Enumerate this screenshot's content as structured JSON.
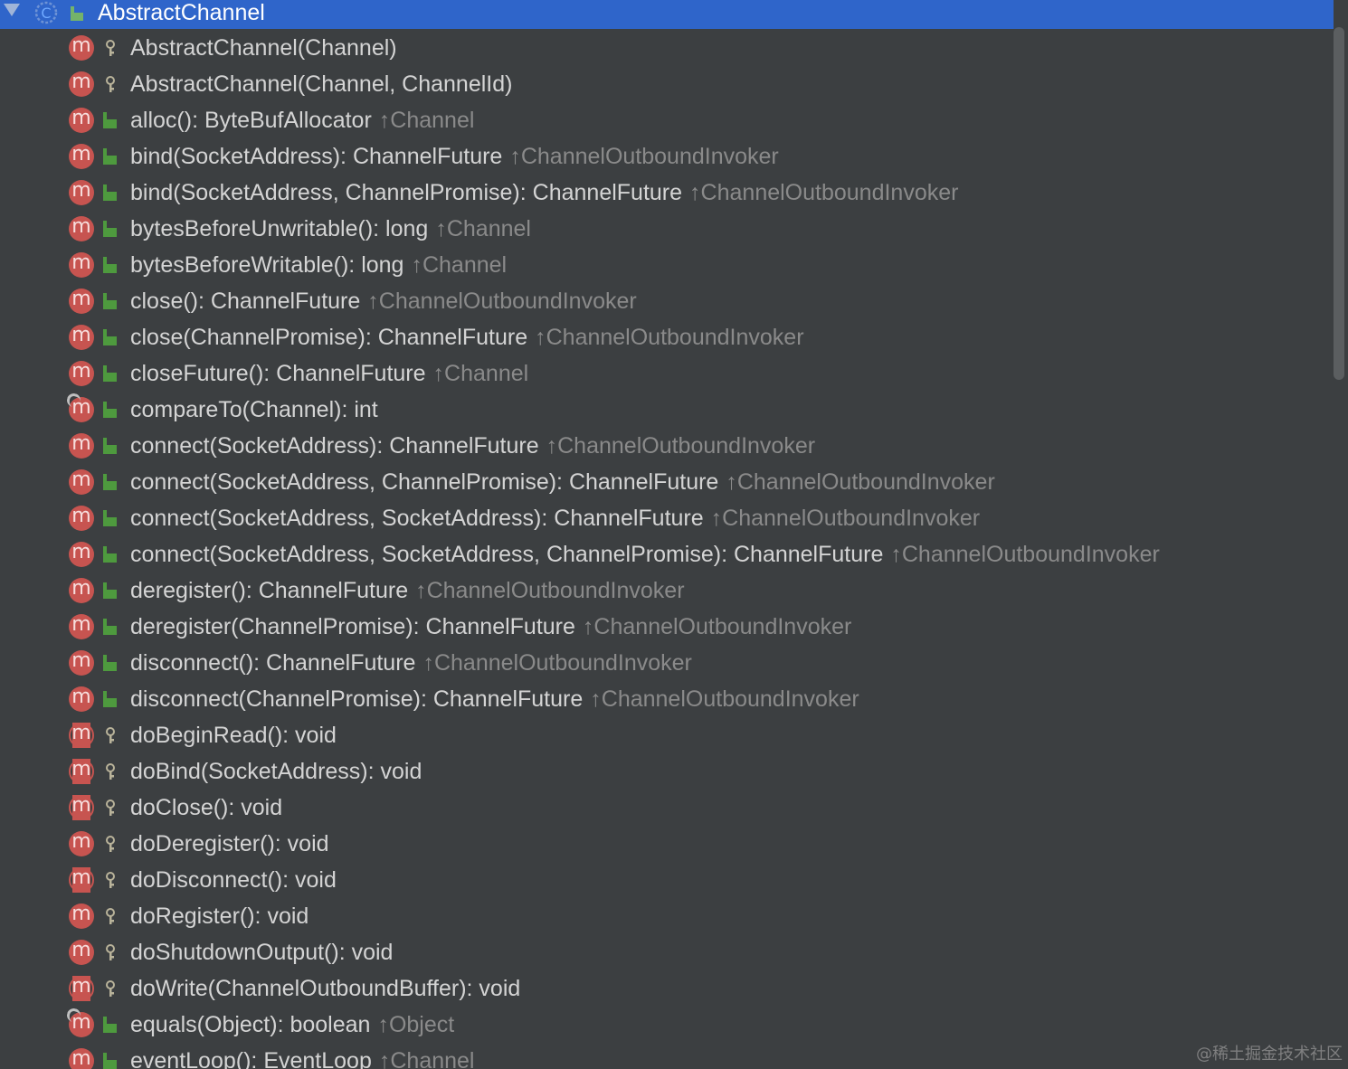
{
  "header": {
    "title": "AbstractChannel",
    "class_icon_letter": "C"
  },
  "members": [
    {
      "sig": "AbstractChannel(Channel)",
      "inherited": "",
      "visibility": "protected-icon",
      "kind": "method"
    },
    {
      "sig": "AbstractChannel(Channel, ChannelId)",
      "inherited": "",
      "visibility": "protected-icon",
      "kind": "method"
    },
    {
      "sig": "alloc(): ByteBufAllocator",
      "inherited": "↑Channel",
      "visibility": "public-icon",
      "kind": "method"
    },
    {
      "sig": "bind(SocketAddress): ChannelFuture",
      "inherited": "↑ChannelOutboundInvoker",
      "visibility": "public-icon",
      "kind": "method"
    },
    {
      "sig": "bind(SocketAddress, ChannelPromise): ChannelFuture",
      "inherited": "↑ChannelOutboundInvoker",
      "visibility": "public-icon",
      "kind": "method"
    },
    {
      "sig": "bytesBeforeUnwritable(): long",
      "inherited": "↑Channel",
      "visibility": "public-icon",
      "kind": "method"
    },
    {
      "sig": "bytesBeforeWritable(): long",
      "inherited": "↑Channel",
      "visibility": "public-icon",
      "kind": "method"
    },
    {
      "sig": "close(): ChannelFuture",
      "inherited": "↑ChannelOutboundInvoker",
      "visibility": "public-icon",
      "kind": "method"
    },
    {
      "sig": "close(ChannelPromise): ChannelFuture",
      "inherited": "↑ChannelOutboundInvoker",
      "visibility": "public-icon",
      "kind": "method"
    },
    {
      "sig": "closeFuture(): ChannelFuture",
      "inherited": "↑Channel",
      "visibility": "public-icon",
      "kind": "method"
    },
    {
      "sig": "compareTo(Channel): int",
      "inherited": "",
      "visibility": "public-icon",
      "kind": "override"
    },
    {
      "sig": "connect(SocketAddress): ChannelFuture",
      "inherited": "↑ChannelOutboundInvoker",
      "visibility": "public-icon",
      "kind": "method"
    },
    {
      "sig": "connect(SocketAddress, ChannelPromise): ChannelFuture",
      "inherited": "↑ChannelOutboundInvoker",
      "visibility": "public-icon",
      "kind": "method"
    },
    {
      "sig": "connect(SocketAddress, SocketAddress): ChannelFuture",
      "inherited": "↑ChannelOutboundInvoker",
      "visibility": "public-icon",
      "kind": "method"
    },
    {
      "sig": "connect(SocketAddress, SocketAddress, ChannelPromise): ChannelFuture",
      "inherited": "↑ChannelOutboundInvoker",
      "visibility": "public-icon",
      "kind": "method"
    },
    {
      "sig": "deregister(): ChannelFuture",
      "inherited": "↑ChannelOutboundInvoker",
      "visibility": "public-icon",
      "kind": "method"
    },
    {
      "sig": "deregister(ChannelPromise): ChannelFuture",
      "inherited": "↑ChannelOutboundInvoker",
      "visibility": "public-icon",
      "kind": "method"
    },
    {
      "sig": "disconnect(): ChannelFuture",
      "inherited": "↑ChannelOutboundInvoker",
      "visibility": "public-icon",
      "kind": "method"
    },
    {
      "sig": "disconnect(ChannelPromise): ChannelFuture",
      "inherited": "↑ChannelOutboundInvoker",
      "visibility": "public-icon",
      "kind": "method"
    },
    {
      "sig": "doBeginRead(): void",
      "inherited": "",
      "visibility": "protected-icon",
      "kind": "abstract"
    },
    {
      "sig": "doBind(SocketAddress): void",
      "inherited": "",
      "visibility": "protected-icon",
      "kind": "abstract"
    },
    {
      "sig": "doClose(): void",
      "inherited": "",
      "visibility": "protected-icon",
      "kind": "abstract"
    },
    {
      "sig": "doDeregister(): void",
      "inherited": "",
      "visibility": "protected-icon",
      "kind": "method"
    },
    {
      "sig": "doDisconnect(): void",
      "inherited": "",
      "visibility": "protected-icon",
      "kind": "abstract"
    },
    {
      "sig": "doRegister(): void",
      "inherited": "",
      "visibility": "protected-icon",
      "kind": "method"
    },
    {
      "sig": "doShutdownOutput(): void",
      "inherited": "",
      "visibility": "protected-icon",
      "kind": "method"
    },
    {
      "sig": "doWrite(ChannelOutboundBuffer): void",
      "inherited": "",
      "visibility": "protected-icon",
      "kind": "abstract"
    },
    {
      "sig": "equals(Object): boolean",
      "inherited": "↑Object",
      "visibility": "public-icon",
      "kind": "override"
    },
    {
      "sig": "eventLoop(): EventLoop",
      "inherited": "↑Channel",
      "visibility": "public-icon",
      "kind": "method"
    }
  ],
  "method_icon_letter": "m",
  "watermark": "@稀土掘金技术社区",
  "colors": {
    "header_bg": "#2f65ca",
    "panel_bg": "#3c3f41",
    "method_icon": "#c75450",
    "public_icon": "#4e9a3e",
    "protected_icon": "#b9b39a"
  }
}
